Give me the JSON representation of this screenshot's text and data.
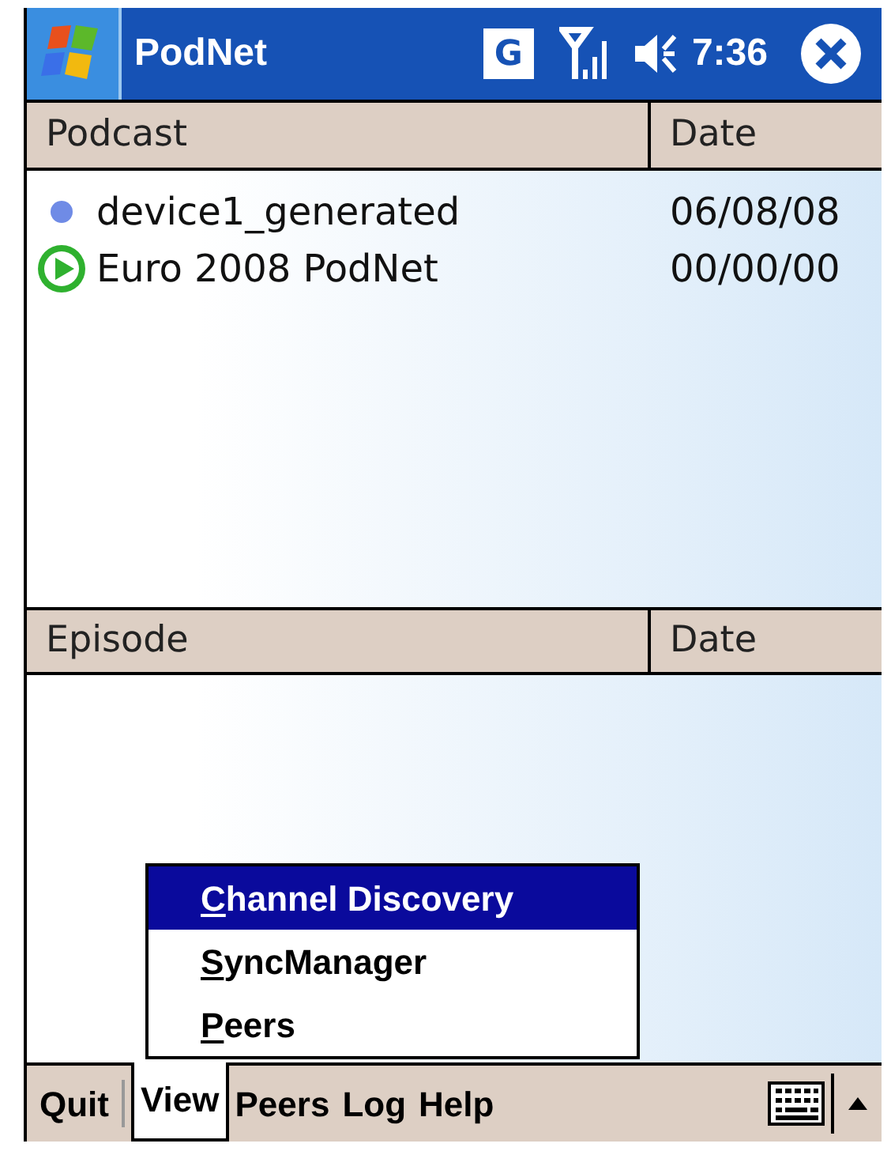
{
  "title_bar": {
    "title": "PodNet",
    "g_badge": "G",
    "time": "7:36"
  },
  "podcasts": {
    "columns": [
      "Podcast",
      "Date"
    ],
    "rows": [
      {
        "kind": "dot",
        "name": "device1_generated",
        "date": "06/08/08"
      },
      {
        "kind": "play",
        "name": "Euro 2008 PodNet",
        "date": "00/00/00"
      }
    ]
  },
  "episodes": {
    "columns": [
      "Episode",
      "Date"
    ]
  },
  "view_menu": [
    {
      "label": "Channel Discovery",
      "selected": true
    },
    {
      "label": "SyncManager",
      "selected": false
    },
    {
      "label": "Peers",
      "selected": false
    }
  ],
  "menu_bar": [
    {
      "label": "Quit",
      "selected": false
    },
    {
      "label": "View",
      "selected": true
    },
    {
      "label": "Peers",
      "selected": false
    },
    {
      "label": "Log",
      "selected": false
    },
    {
      "label": "Help",
      "selected": false
    }
  ]
}
